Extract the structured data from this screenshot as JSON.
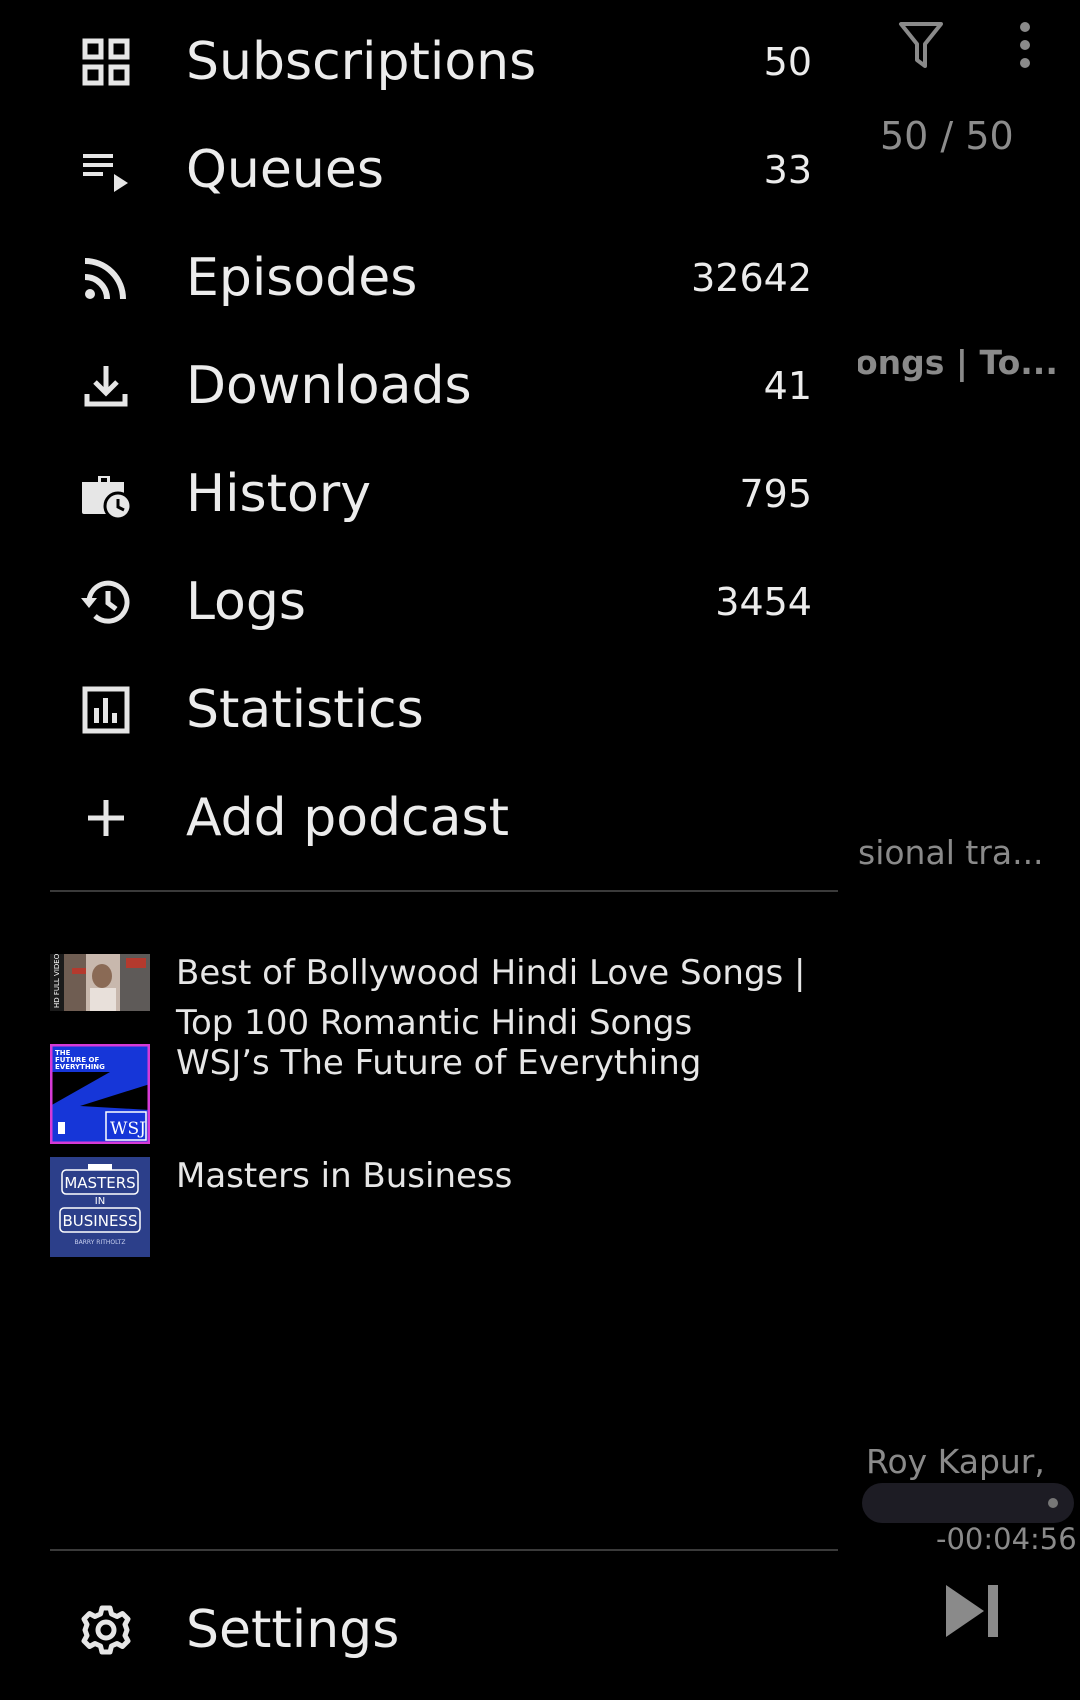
{
  "background_app": {
    "count_text": "50 / 50",
    "episode_title_fragment": "ongs | To...",
    "episode_desc_fragment": "sional tra...",
    "artist_fragment": "Roy Kapur,",
    "time_remaining": "-00:04:56",
    "progress": 0.98,
    "icons": [
      "filter-icon",
      "more-vert-icon",
      "skip-next-icon"
    ]
  },
  "drawer": {
    "nav": [
      {
        "label": "Subscriptions",
        "count": "50",
        "icon": "grid-icon"
      },
      {
        "label": "Queues",
        "count": "33",
        "icon": "queue-icon"
      },
      {
        "label": "Episodes",
        "count": "32642",
        "icon": "rss-icon"
      },
      {
        "label": "Downloads",
        "count": "41",
        "icon": "download-icon"
      },
      {
        "label": "History",
        "count": "795",
        "icon": "history-briefcase-icon"
      },
      {
        "label": "Logs",
        "count": "3454",
        "icon": "logs-history-icon"
      },
      {
        "label": "Statistics",
        "count": "",
        "icon": "statistics-icon"
      },
      {
        "label": "Add podcast",
        "count": "",
        "icon": "plus-icon"
      }
    ],
    "podcasts": [
      {
        "title": "Best of Bollywood Hindi Love Songs | Top 100 Romantic Hindi Songs",
        "art_text": "HD FULL VIDEO"
      },
      {
        "title": "WSJ’s The Future of Everything",
        "art_text_top": "THE FUTURE OF EVERYTHING",
        "art_text_logo": "WSJ"
      },
      {
        "title": "Masters in Business",
        "art_text_1": "MASTERS",
        "art_text_2": "IN",
        "art_text_3": "BUSINESS",
        "art_text_4": "BARRY RITHOLTZ"
      }
    ],
    "settings_label": "Settings"
  }
}
